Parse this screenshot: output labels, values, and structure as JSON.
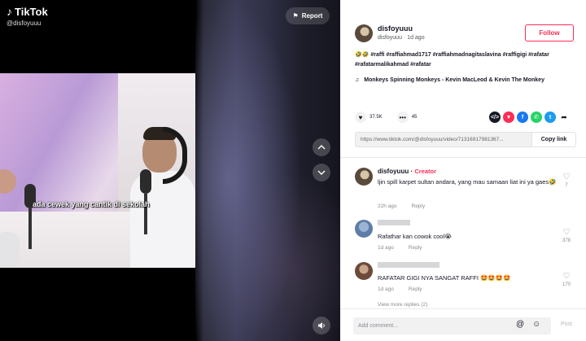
{
  "video": {
    "brand": "TikTok",
    "handle": "@disfoyuuu",
    "caption": "ada cewek yang cantik di sekolah",
    "report_label": "Report"
  },
  "author": {
    "username": "disfoyuuu",
    "sub": "disfoyuuu · 1d ago",
    "follow_label": "Follow"
  },
  "description": "🤣🤣 #raffi #raffiahmad1717 #raffiahmadnagitaslavina #raffigigi #rafatar #rafatarmalikahmad #rafatar",
  "music": {
    "icon": "music-note-icon",
    "title": "Monkeys Spinning Monkeys - Kevin MacLeod & Kevin The Monkey"
  },
  "stats": {
    "likes": "37.5K",
    "comments": "45"
  },
  "share": {
    "icons": [
      "embed-icon",
      "send-icon",
      "facebook-icon",
      "whatsapp-icon",
      "twitter-icon",
      "forward-icon"
    ],
    "colors": [
      "#161823",
      "#fe2c55",
      "#1877f2",
      "#25d366",
      "#1d9bf0",
      "#161823"
    ]
  },
  "link": {
    "url": "https://www.tiktok.com/@disfoyuuu/video/71316917981367...",
    "copy_label": "Copy link"
  },
  "comments": [
    {
      "name": "disfoyuuu",
      "badge": "Creator",
      "text": "ljin spill karpet sultan andara, yang mau samaan liat ini ya gaes🤣",
      "time": "22h ago",
      "reply": "Reply",
      "likes": "7"
    },
    {
      "name": "",
      "badge": "",
      "text": "Rafathar kan cowok cool😭",
      "time": "1d ago",
      "reply": "Reply",
      "likes": "378"
    },
    {
      "name": "",
      "badge": "",
      "text": "RAFATAR GIGI NYA SANGAT RAFFI 🤩🤩🤩🤩",
      "time": "1d ago",
      "reply": "Reply",
      "likes": "170"
    }
  ],
  "view_more": "View more replies (2)",
  "composer": {
    "placeholder": "Add comment...",
    "post_label": "Post"
  },
  "colors": {
    "accent": "#fe2c55",
    "text": "#161823",
    "muted": "#8a8b91"
  }
}
